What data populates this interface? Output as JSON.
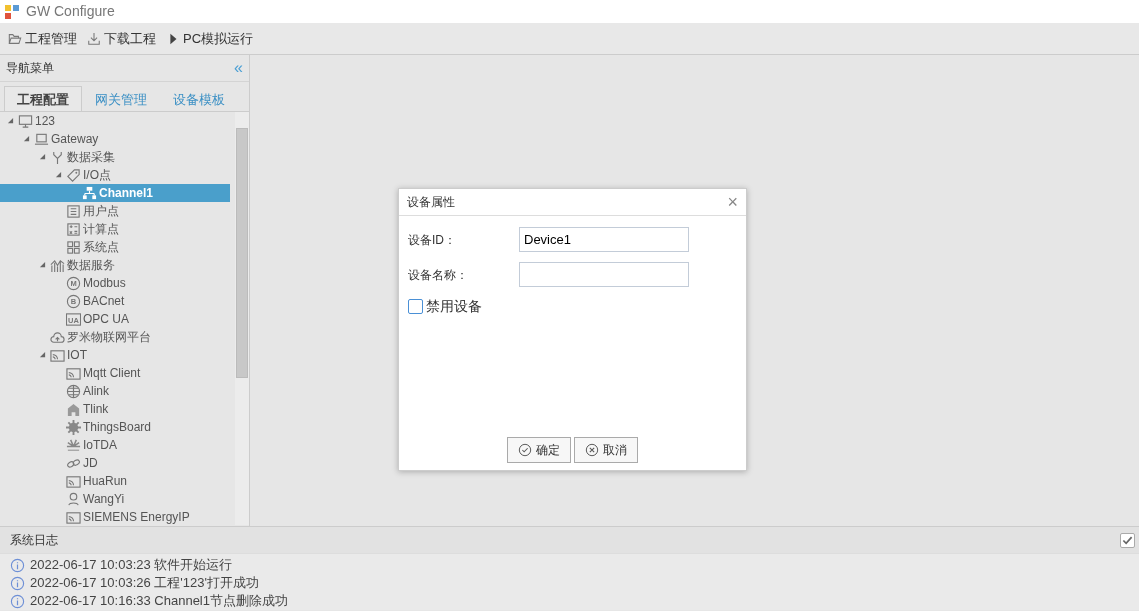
{
  "window": {
    "title": "GW Configure"
  },
  "toolbar": [
    {
      "label": "工程管理",
      "kind": "folder"
    },
    {
      "label": "下载工程",
      "kind": "download"
    },
    {
      "label": "PC模拟运行",
      "kind": "play"
    }
  ],
  "nav": {
    "title": "导航菜单",
    "collapse": "«",
    "tabs": [
      {
        "label": "工程配置",
        "selected": true
      },
      {
        "label": "网关管理",
        "selected": false
      },
      {
        "label": "设备模板",
        "selected": false
      }
    ],
    "tree": [
      {
        "label": "123",
        "kind": "monitor",
        "expanded": true,
        "selected": false,
        "children": [
          {
            "label": "Gateway",
            "kind": "laptop",
            "expanded": true,
            "selected": false,
            "children": [
              {
                "label": "数据采集",
                "kind": "branch",
                "expanded": true,
                "selected": false,
                "children": [
                  {
                    "label": "I/O点",
                    "kind": "tag",
                    "expanded": true,
                    "selected": false,
                    "children": [
                      {
                        "label": "Channel1",
                        "kind": "network",
                        "selected": true
                      }
                    ]
                  },
                  {
                    "label": "用户点",
                    "kind": "list",
                    "selected": false
                  },
                  {
                    "label": "计算点",
                    "kind": "calc",
                    "selected": false
                  },
                  {
                    "label": "系统点",
                    "kind": "grid",
                    "selected": false
                  }
                ]
              },
              {
                "label": "数据服务",
                "kind": "chart",
                "expanded": true,
                "selected": false,
                "children": [
                  {
                    "label": "Modbus",
                    "kind": "m",
                    "icon_text": "M",
                    "selected": false
                  },
                  {
                    "label": "BACnet",
                    "kind": "b",
                    "icon_text": "B",
                    "selected": false
                  },
                  {
                    "label": "OPC UA",
                    "kind": "ua",
                    "icon_text": "UA",
                    "selected": false
                  }
                ]
              },
              {
                "label": "罗米物联网平台",
                "kind": "cloud",
                "selected": false
              },
              {
                "label": "IOT",
                "kind": "cast",
                "expanded": true,
                "selected": false,
                "children": [
                  {
                    "label": "Mqtt Client",
                    "kind": "cast",
                    "selected": false
                  },
                  {
                    "label": "Alink",
                    "kind": "globe",
                    "selected": false
                  },
                  {
                    "label": "Tlink",
                    "kind": "house",
                    "selected": false
                  },
                  {
                    "label": "ThingsBoard",
                    "kind": "gear",
                    "selected": false
                  },
                  {
                    "label": "IoTDA",
                    "kind": "flower",
                    "selected": false
                  },
                  {
                    "label": "JD",
                    "kind": "link",
                    "selected": false
                  },
                  {
                    "label": "HuaRun",
                    "kind": "cast",
                    "selected": false
                  },
                  {
                    "label": "WangYi",
                    "kind": "person",
                    "selected": false
                  },
                  {
                    "label": "SIEMENS EnergyIP",
                    "kind": "cast",
                    "selected": false
                  }
                ]
              }
            ]
          }
        ]
      }
    ]
  },
  "dialog": {
    "title": "设备属性",
    "close": "×",
    "fields": [
      {
        "label": "设备ID：",
        "value": "Device1"
      },
      {
        "label": "设备名称："
      }
    ],
    "checkbox": {
      "label": "禁用设备",
      "checked": false
    },
    "buttons": [
      {
        "label": "确定",
        "kind": "ok"
      },
      {
        "label": "取消",
        "kind": "cancel"
      }
    ]
  },
  "log": {
    "title": "系统日志",
    "auto_scroll": {
      "checked": true
    },
    "entries": [
      "2022-06-17 10:03:23 软件开始运行",
      "2022-06-17 10:03:26 工程'123'打开成功",
      "2022-06-17 10:16:33 Channel1节点删除成功"
    ]
  }
}
